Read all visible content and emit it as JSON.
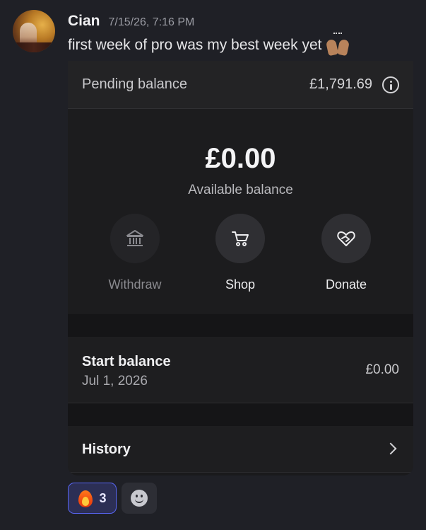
{
  "message": {
    "username": "Cian",
    "timestamp": "7/15/26, 7:16 PM",
    "text": "first week of pro was my best week yet",
    "emoji": "raising-hands-icon"
  },
  "card": {
    "pending": {
      "label": "Pending balance",
      "amount": "£1,791.69",
      "icon": "info-icon"
    },
    "available": {
      "amount": "£0.00",
      "label": "Available balance"
    },
    "actions": [
      {
        "label": "Withdraw",
        "icon": "bank-icon",
        "enabled": false
      },
      {
        "label": "Shop",
        "icon": "cart-icon",
        "enabled": true
      },
      {
        "label": "Donate",
        "icon": "heart-hands-icon",
        "enabled": true
      }
    ],
    "start_balance": {
      "title": "Start balance",
      "date": "Jul 1, 2026",
      "amount": "£0.00"
    },
    "history": {
      "label": "History",
      "icon": "chevron-right-icon"
    }
  },
  "reactions": [
    {
      "icon": "fire-icon",
      "count": "3",
      "selected": true
    },
    {
      "icon": "add-reaction-icon"
    }
  ],
  "colors": {
    "background": "#1f2026",
    "reaction_selected_border": "#5865f2"
  }
}
